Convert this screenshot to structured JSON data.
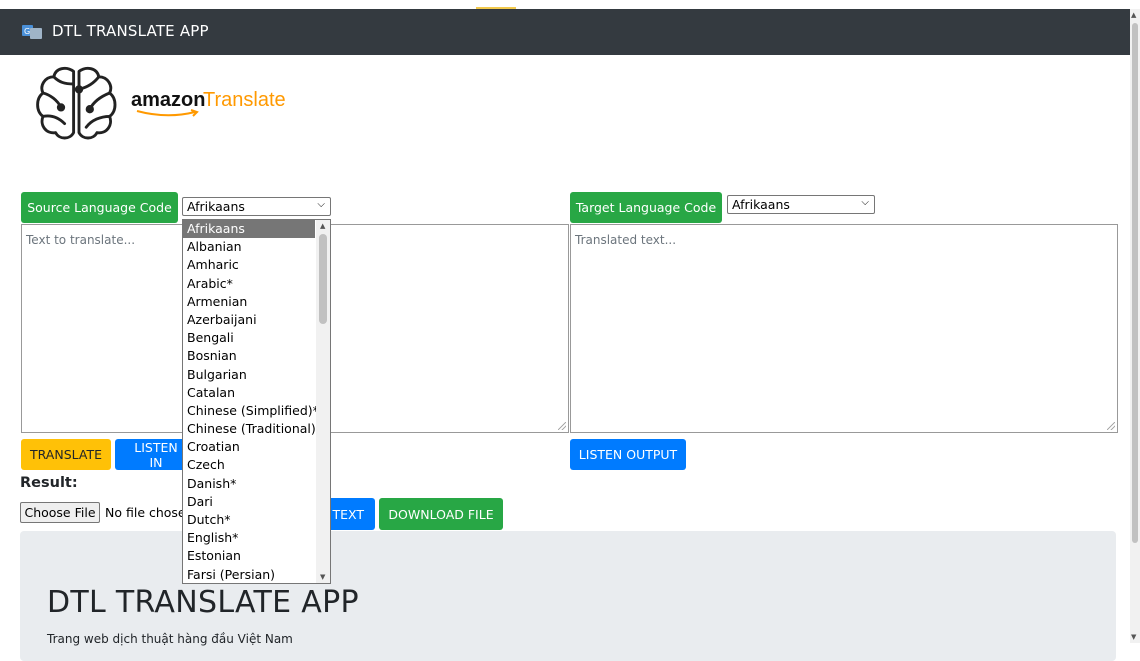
{
  "navbar": {
    "title": "DTL TRANSLATE APP"
  },
  "logo": {
    "word1": "amazon",
    "word2": "Translate"
  },
  "source": {
    "label": "Source Language Code",
    "selected": "Afrikaans",
    "placeholder": "Text to translate..."
  },
  "target": {
    "label": "Target Language Code",
    "selected": "Afrikaans",
    "placeholder": "Translated text..."
  },
  "dropdown": {
    "options": [
      "Afrikaans",
      "Albanian",
      "Amharic",
      "Arabic*",
      "Armenian",
      "Azerbaijani",
      "Bengali",
      "Bosnian",
      "Bulgarian",
      "Catalan",
      "Chinese (Simplified)*",
      "Chinese (Traditional)",
      "Croatian",
      "Czech",
      "Danish*",
      "Dari",
      "Dutch*",
      "English*",
      "Estonian",
      "Farsi (Persian)"
    ]
  },
  "buttons": {
    "translate": "TRANSLATE",
    "listen_input": "LISTEN IN",
    "listen_output": "LISTEN OUTPUT",
    "text_btn": "T TEXT",
    "download": "DOWNLOAD FILE"
  },
  "result": {
    "label": "Result:"
  },
  "file": {
    "choose": "Choose File",
    "status": "No file chose"
  },
  "jumbotron": {
    "title": "DTL TRANSLATE APP",
    "subtitle": "Trang web dịch thuật hàng đầu Việt Nam"
  },
  "colors": {
    "navbar": "#343a40",
    "green": "#28a745",
    "yellow": "#ffc107",
    "blue": "#007bff",
    "amazon_orange": "#ff9900"
  }
}
